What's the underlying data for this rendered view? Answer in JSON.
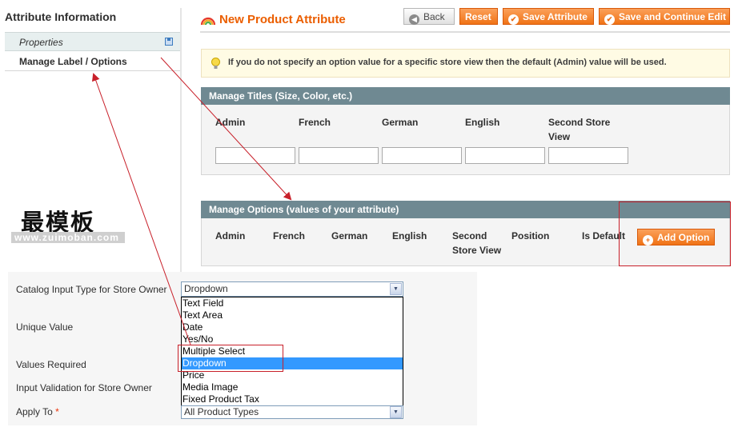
{
  "sidebar": {
    "title": "Attribute Information",
    "tabs": [
      {
        "label": "Properties",
        "icon": "floppy-disk-icon"
      },
      {
        "label": "Manage Label / Options"
      }
    ]
  },
  "header": {
    "title": "New Product Attribute",
    "icon": "rainbow-icon",
    "buttons": {
      "back": "Back",
      "reset": "Reset",
      "save": "Save Attribute",
      "save_continue": "Save and Continue Edit"
    }
  },
  "notice": {
    "text": "If you do not specify an option value for a specific store view then the default (Admin) value will be used.",
    "icon": "lightbulb-icon"
  },
  "manage_titles": {
    "heading": "Manage Titles (Size, Color, etc.)",
    "columns": [
      "Admin",
      "French",
      "German",
      "English",
      "Second Store View"
    ]
  },
  "manage_options": {
    "heading": "Manage Options (values of your attribute)",
    "columns": [
      "Admin",
      "French",
      "German",
      "English",
      "Second Store View",
      "Position",
      "Is Default"
    ],
    "add_button": "Add Option"
  },
  "watermark": {
    "title": "最模板",
    "url": "www.zuimoban.com"
  },
  "properties_form": {
    "labels": {
      "input_type": "Catalog Input Type for Store Owner",
      "unique": "Unique Value",
      "required": "Values Required",
      "validation": "Input Validation for Store Owner",
      "apply_to": "Apply To",
      "apply_to_required_mark": "*"
    },
    "input_type_value": "Dropdown",
    "input_type_options": [
      "Text Field",
      "Text Area",
      "Date",
      "Yes/No",
      "Multiple Select",
      "Dropdown",
      "Price",
      "Media Image",
      "Fixed Product Tax"
    ],
    "selected_option": "Dropdown",
    "apply_to_value": "All Product Types"
  },
  "colors": {
    "accent": "#eb5e00",
    "button_orange": "#f07316",
    "fieldset_header": "#6f8992",
    "annotation_red": "#c8202a",
    "selection_blue": "#3399ff"
  }
}
